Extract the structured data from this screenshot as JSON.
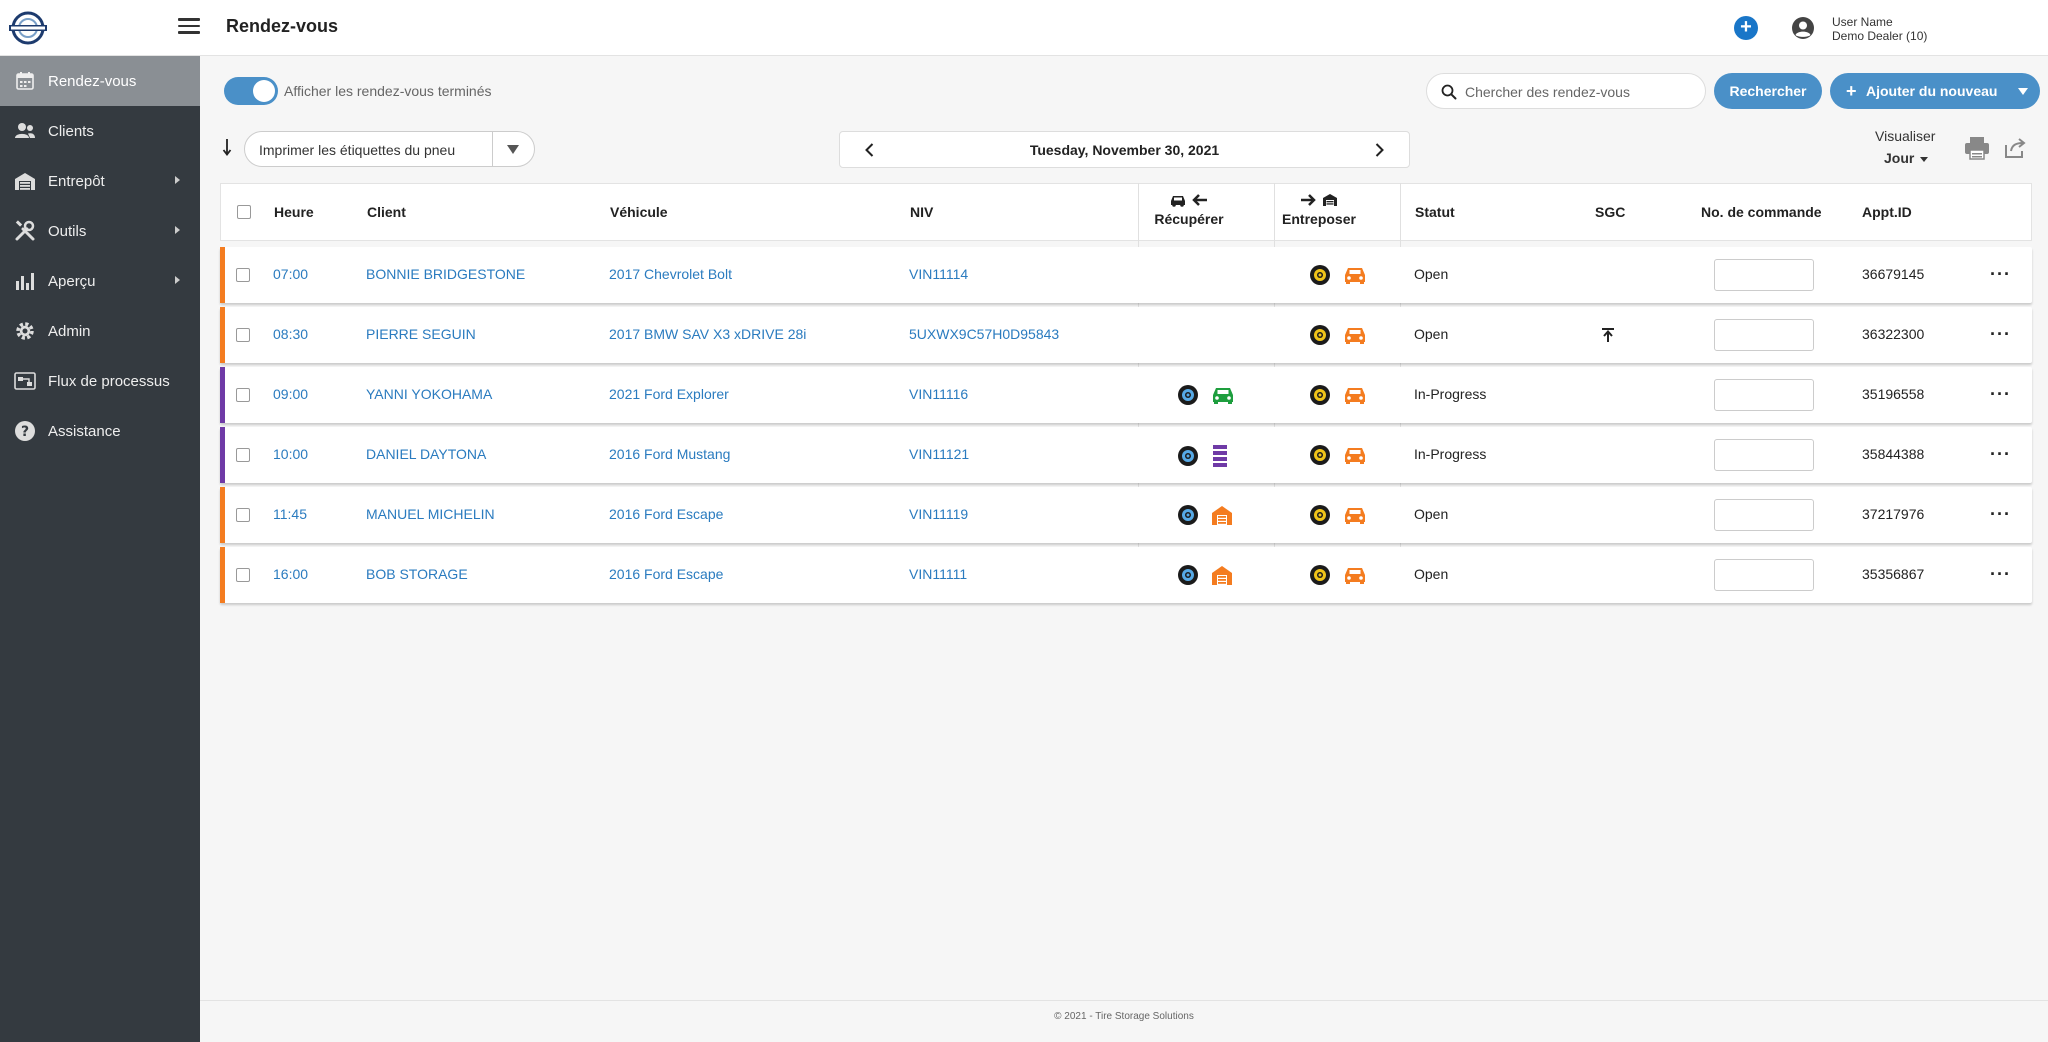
{
  "header": {
    "title": "Rendez-vous",
    "user_name": "User Name",
    "user_dealer": "Demo Dealer (10)",
    "plus_label": "+"
  },
  "sidebar": {
    "items": [
      {
        "label": "Rendez-vous",
        "icon": "calendar-icon",
        "active": true
      },
      {
        "label": "Clients",
        "icon": "users-icon"
      },
      {
        "label": "Entrepôt",
        "icon": "warehouse-icon",
        "submenu": true
      },
      {
        "label": "Outils",
        "icon": "tools-icon",
        "submenu": true
      },
      {
        "label": "Aperçu",
        "icon": "chart-icon",
        "submenu": true
      },
      {
        "label": "Admin",
        "icon": "gear-icon"
      },
      {
        "label": "Flux de processus",
        "icon": "workflow-icon"
      },
      {
        "label": "Assistance",
        "icon": "help-icon"
      }
    ]
  },
  "toolbar": {
    "toggle_label": "Afficher les rendez-vous terminés",
    "search_placeholder": "Chercher des rendez-vous",
    "search_button": "Rechercher",
    "add_button": "Ajouter du nouveau",
    "print_select": "Imprimer les étiquettes du pneu",
    "date": "Tuesday, November 30, 2021",
    "view_label": "Visualiser",
    "view_value": "Jour"
  },
  "table": {
    "columns": {
      "heure": "Heure",
      "client": "Client",
      "vehicule": "Véhicule",
      "niv": "NIV",
      "recuperer": "Récupérer",
      "entreposer": "Entreposer",
      "statut": "Statut",
      "sgc": "SGC",
      "commande": "No. de commande",
      "apptid": "Appt.ID"
    },
    "rows": [
      {
        "time": "07:00",
        "client": "BONNIE BRIDGESTONE",
        "vehicle": "2017 Chevrolet Bolt",
        "vin": "VIN11114",
        "status": "Open",
        "appt": "36679145",
        "bar": "#f47c20",
        "pickup": "none",
        "sgc": false
      },
      {
        "time": "08:30",
        "client": "PIERRE SEGUIN",
        "vehicle": "2017 BMW SAV X3 xDRIVE 28i",
        "vin": "5UXWX9C57H0D95843",
        "status": "Open",
        "appt": "36322300",
        "bar": "#f47c20",
        "pickup": "none",
        "sgc": true
      },
      {
        "time": "09:00",
        "client": "YANNI YOKOHAMA",
        "vehicle": "2021 Ford Explorer",
        "vin": "VIN11116",
        "status": "In-Progress",
        "appt": "35196558",
        "bar": "#6f3aa6",
        "pickup": "car-green",
        "sgc": false
      },
      {
        "time": "10:00",
        "client": "DANIEL DAYTONA",
        "vehicle": "2016 Ford Mustang",
        "vin": "VIN11121",
        "status": "In-Progress",
        "appt": "35844388",
        "bar": "#6f3aa6",
        "pickup": "rack-purple",
        "sgc": false
      },
      {
        "time": "11:45",
        "client": "MANUEL MICHELIN",
        "vehicle": "2016 Ford Escape",
        "vin": "VIN11119",
        "status": "Open",
        "appt": "37217976",
        "bar": "#f47c20",
        "pickup": "warehouse-orange",
        "sgc": false
      },
      {
        "time": "16:00",
        "client": "BOB STORAGE",
        "vehicle": "2016 Ford Escape",
        "vin": "VIN11111",
        "status": "Open",
        "appt": "35356867",
        "bar": "#f47c20",
        "pickup": "warehouse-orange",
        "sgc": false
      }
    ]
  },
  "footer": {
    "copyright": "© 2021 - Tire Storage Solutions"
  },
  "colors": {
    "accent": "#4a90c8",
    "link": "#2a7bbf",
    "sidebar": "#343a40",
    "open_bar": "#f47c20",
    "progress_bar": "#6f3aa6"
  }
}
